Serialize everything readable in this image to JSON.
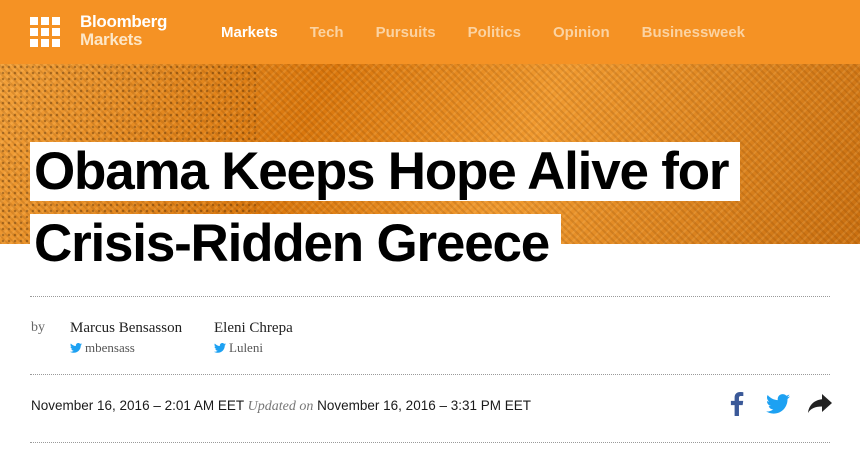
{
  "nav": {
    "brand_line1": "Bloomberg",
    "brand_line2": "Markets",
    "links": [
      "Markets",
      "Tech",
      "Pursuits",
      "Politics",
      "Opinion",
      "Businessweek"
    ],
    "active": "Markets",
    "menu_icon": "grid-menu-icon",
    "colors": {
      "bar": "#f59224",
      "active_link": "#ffffff",
      "inactive_link": "#fbd3a2"
    }
  },
  "article": {
    "headline_line1": "Obama Keeps Hope Alive for",
    "headline_line2": "Crisis-Ridden Greece",
    "by_label": "by",
    "authors": [
      {
        "name": "Marcus Bensasson",
        "handle": "mbensass"
      },
      {
        "name": "Eleni Chrepa",
        "handle": "Luleni"
      }
    ],
    "dateline": {
      "published": "November 16, 2016 – 2:01 AM EET",
      "updated_label": "Updated on",
      "updated": "November 16, 2016 – 3:31 PM EET"
    }
  },
  "share": {
    "icons": [
      "facebook-icon",
      "twitter-icon",
      "share-arrow-icon"
    ],
    "colors": {
      "facebook": "#3b5998",
      "twitter": "#1da1f2",
      "share": "#222222"
    }
  }
}
